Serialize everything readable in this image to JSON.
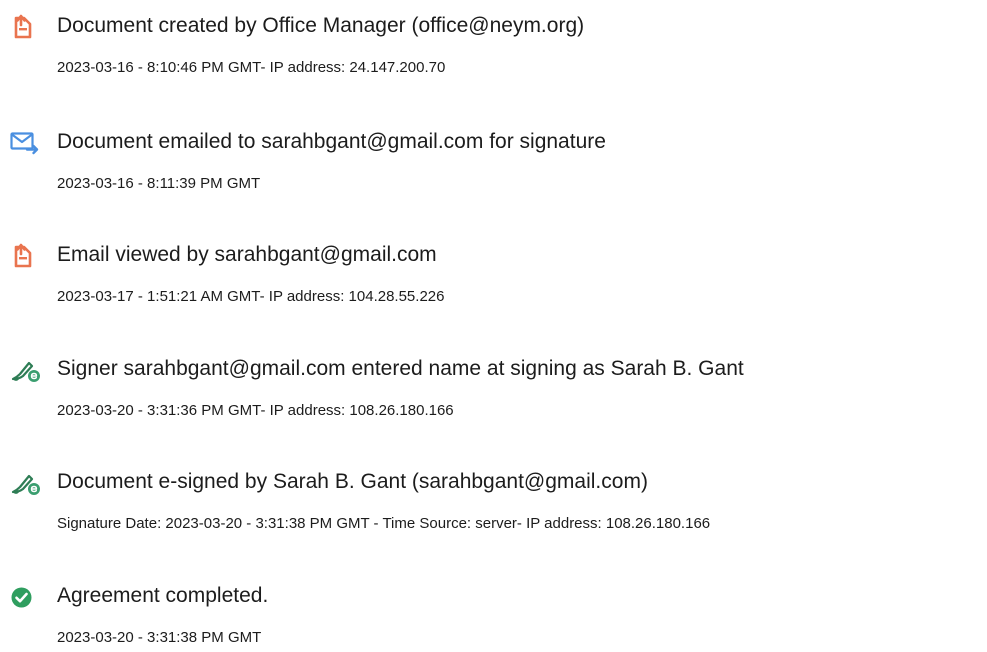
{
  "events": [
    {
      "icon": "document-created-icon",
      "title": "Document created by Office Manager (office@neym.org)",
      "detail": "2023-03-16 - 8:10:46 PM GMT- IP address: 24.147.200.70"
    },
    {
      "icon": "email-sent-icon",
      "title": "Document emailed to sarahbgant@gmail.com for signature",
      "detail": "2023-03-16 - 8:11:39 PM GMT"
    },
    {
      "icon": "document-viewed-icon",
      "title": "Email viewed by sarahbgant@gmail.com",
      "detail": "2023-03-17 - 1:51:21 AM GMT- IP address: 104.28.55.226"
    },
    {
      "icon": "signer-pen-icon",
      "title": "Signer sarahbgant@gmail.com entered name at signing as Sarah B. Gant",
      "detail": "2023-03-20 - 3:31:36 PM GMT- IP address: 108.26.180.166"
    },
    {
      "icon": "e-sign-pen-icon",
      "title": "Document e-signed by Sarah B. Gant (sarahbgant@gmail.com)",
      "detail": "Signature Date: 2023-03-20 - 3:31:38 PM GMT - Time Source: server- IP address: 108.26.180.166"
    },
    {
      "icon": "check-circle-icon",
      "title": "Agreement completed.",
      "detail": "2023-03-20 - 3:31:38 PM GMT"
    }
  ],
  "colors": {
    "document_icon": "#e9744f",
    "email_icon": "#4a8fe0",
    "pen_icon": "#3a9e6f",
    "check_icon": "#2f9e5f",
    "text": "#1c1c1c"
  }
}
